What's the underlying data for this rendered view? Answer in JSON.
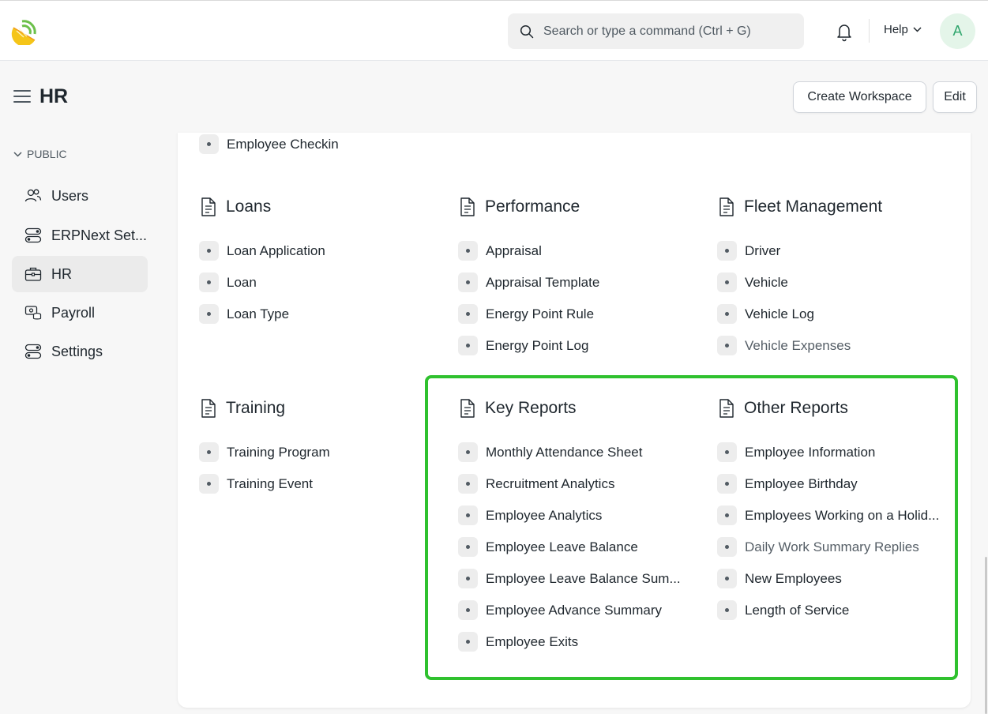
{
  "navbar": {
    "search_placeholder": "Search or type a command (Ctrl + G)",
    "help_label": "Help",
    "avatar_initial": "A"
  },
  "page": {
    "title": "HR",
    "create_workspace_label": "Create Workspace",
    "edit_label": "Edit"
  },
  "sidebar": {
    "section_label": "PUBLIC",
    "items": [
      {
        "label": "Users",
        "icon": "users-icon"
      },
      {
        "label": "ERPNext Set...",
        "icon": "toggle-settings-icon"
      },
      {
        "label": "HR",
        "icon": "briefcase-icon"
      },
      {
        "label": "Payroll",
        "icon": "money-icon"
      },
      {
        "label": "Settings",
        "icon": "toggle-settings-icon"
      }
    ]
  },
  "content": {
    "top_link": "Employee Checkin",
    "loans": {
      "title": "Loans",
      "links": [
        "Loan Application",
        "Loan",
        "Loan Type"
      ]
    },
    "performance": {
      "title": "Performance",
      "links": [
        "Appraisal",
        "Appraisal Template",
        "Energy Point Rule",
        "Energy Point Log"
      ]
    },
    "fleet": {
      "title": "Fleet Management",
      "links": [
        "Driver",
        "Vehicle",
        "Vehicle Log",
        "Vehicle Expenses"
      ]
    },
    "training": {
      "title": "Training",
      "links": [
        "Training Program",
        "Training Event"
      ]
    },
    "key_reports": {
      "title": "Key Reports",
      "links": [
        "Monthly Attendance Sheet",
        "Recruitment Analytics",
        "Employee Analytics",
        "Employee Leave Balance",
        "Employee Leave Balance Sum...",
        "Employee Advance Summary",
        "Employee Exits"
      ]
    },
    "other_reports": {
      "title": "Other Reports",
      "links": [
        "Employee Information",
        "Employee Birthday",
        "Employees Working on a Holid...",
        "Daily Work Summary Replies",
        "New Employees",
        "Length of Service"
      ]
    }
  },
  "colors": {
    "highlight_border": "#2fc12e",
    "active_sidebar_bg": "#ebebeb",
    "avatar_bg": "#e4f5e9",
    "avatar_text": "#30a66d"
  }
}
